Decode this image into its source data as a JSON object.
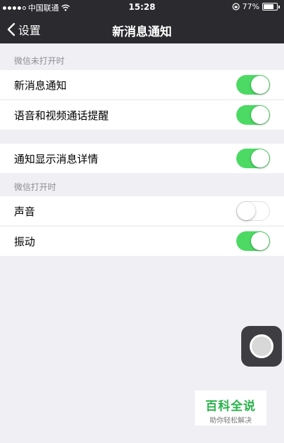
{
  "status_bar": {
    "carrier": "中国联通",
    "time": "15:28",
    "battery_percent_text": "77%",
    "battery_level": 0.77
  },
  "nav": {
    "back_label": "设置",
    "title": "新消息通知"
  },
  "sections": [
    {
      "header": "微信未打开时",
      "rows": [
        {
          "label": "新消息通知",
          "on": true
        },
        {
          "label": "语音和视频通话提醒",
          "on": true
        }
      ]
    },
    {
      "header": "",
      "rows": [
        {
          "label": "通知显示消息详情",
          "on": true
        }
      ]
    },
    {
      "header": "微信打开时",
      "rows": [
        {
          "label": "声音",
          "on": false
        },
        {
          "label": "振动",
          "on": true
        }
      ]
    }
  ],
  "watermark": {
    "title": "百科全说",
    "subtitle": "助你轻松解决"
  },
  "colors": {
    "toggle_on": "#4cd964",
    "nav_bg": "#2b2b2f",
    "page_bg": "#efeff4"
  }
}
